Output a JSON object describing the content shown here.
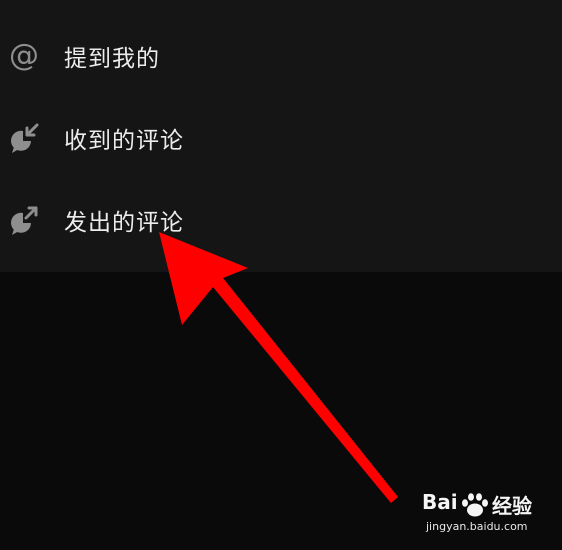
{
  "menu": {
    "items": [
      {
        "label": "提到我的",
        "icon": "at-icon"
      },
      {
        "label": "收到的评论",
        "icon": "comment-received-icon"
      },
      {
        "label": "发出的评论",
        "icon": "comment-sent-icon"
      }
    ],
    "at_symbol": "@"
  },
  "colors": {
    "panel_background": "#151515",
    "page_background": "#0a0a0a",
    "label_text": "#ececec",
    "icon": "#8e8e8e",
    "annotation_arrow": "#ff0000"
  },
  "watermark": {
    "brand_left": "Bai",
    "brand_right": "经验",
    "url": "jingyan.baidu.com"
  }
}
